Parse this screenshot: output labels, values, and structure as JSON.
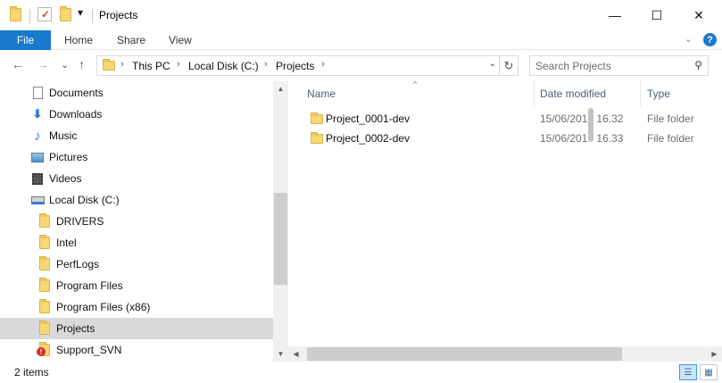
{
  "window": {
    "title": "Projects",
    "minimize_glyph": "—",
    "maximize_glyph": "☐",
    "close_glyph": "✕"
  },
  "quick_access": {
    "dropdown_glyph": "▾"
  },
  "ribbon": {
    "tabs": [
      "File",
      "Home",
      "Share",
      "View"
    ],
    "expand_glyph": "⌄",
    "help_glyph": "?"
  },
  "navigation": {
    "back_glyph": "←",
    "forward_glyph": "→",
    "recent_glyph": "⌄",
    "up_glyph": "↑",
    "breadcrumb": [
      "This PC",
      "Local Disk (C:)",
      "Projects"
    ],
    "crumb_separator": "›",
    "address_dropdown_glyph": "⌄",
    "refresh_glyph": "↻"
  },
  "search": {
    "placeholder": "Search Projects",
    "icon_glyph": "⚲"
  },
  "nav_pane": {
    "items": [
      {
        "label": "Documents",
        "icon": "documents-icon",
        "indent": false
      },
      {
        "label": "Downloads",
        "icon": "downloads-icon",
        "indent": false
      },
      {
        "label": "Music",
        "icon": "music-icon",
        "indent": false
      },
      {
        "label": "Pictures",
        "icon": "pictures-icon",
        "indent": false
      },
      {
        "label": "Videos",
        "icon": "videos-icon",
        "indent": false
      },
      {
        "label": "Local Disk (C:)",
        "icon": "drive-icon",
        "indent": false
      },
      {
        "label": "DRIVERS",
        "icon": "folder-icon",
        "indent": true
      },
      {
        "label": "Intel",
        "icon": "folder-icon",
        "indent": true
      },
      {
        "label": "PerfLogs",
        "icon": "folder-icon",
        "indent": true
      },
      {
        "label": "Program Files",
        "icon": "folder-icon",
        "indent": true
      },
      {
        "label": "Program Files (x86)",
        "icon": "folder-icon",
        "indent": true
      },
      {
        "label": "Projects",
        "icon": "folder-icon",
        "indent": true,
        "selected": true
      },
      {
        "label": "Support_SVN",
        "icon": "svn-conflict-folder-icon",
        "indent": true
      }
    ],
    "scroll_up_glyph": "▲",
    "scroll_down_glyph": "▼"
  },
  "file_list": {
    "columns": [
      "Name",
      "Date modified",
      "Type"
    ],
    "sort_glyph": "^",
    "rows": [
      {
        "name": "Project_0001-dev",
        "date_a": "15/06/201",
        "date_b": "16.32",
        "type": "File folder"
      },
      {
        "name": "Project_0002-dev",
        "date_a": "15/06/201",
        "date_b": "16.33",
        "type": "File folder"
      }
    ],
    "scroll_left_glyph": "◀",
    "scroll_right_glyph": "▶"
  },
  "status_bar": {
    "item_count": "2 items",
    "details_view_glyph": "☰",
    "large_icons_glyph": "▦"
  },
  "colors": {
    "accent": "#1979ca",
    "selection": "#d9d9d9",
    "column_header": "#4c607a",
    "folder": "#f7d774"
  }
}
